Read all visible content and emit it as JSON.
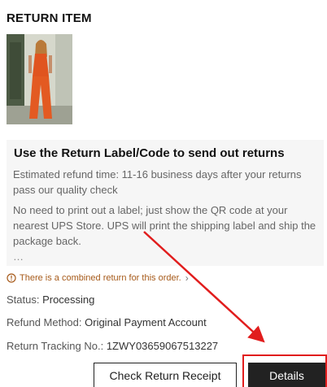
{
  "page": {
    "title": "RETURN ITEM"
  },
  "item": {
    "image_icon": "product-photo-woman-orange-jumpsuit"
  },
  "info": {
    "heading": "Use the Return Label/Code to send out returns",
    "refund_time": "Estimated refund time: 11-16 business days after your returns pass our quality check",
    "instructions": "No need to print out a label; just show the QR code at your nearest UPS Store. UPS will print the shipping label and ship the package back.",
    "ellipsis": "…"
  },
  "notice": {
    "text": "There is a combined return for this order.",
    "chevron": "›"
  },
  "status": {
    "label": "Status: ",
    "value": "Processing"
  },
  "refund_method": {
    "label": "Refund Method: ",
    "value": "Original Payment Account"
  },
  "tracking": {
    "label": "Return Tracking No.: ",
    "value": "1ZWY03659067513227"
  },
  "buttons": {
    "check_receipt": "Check Return Receipt",
    "details": "Details"
  },
  "colors": {
    "annotation": "#e11d1d",
    "notice": "#a65a1a",
    "primary_button": "#222222"
  }
}
